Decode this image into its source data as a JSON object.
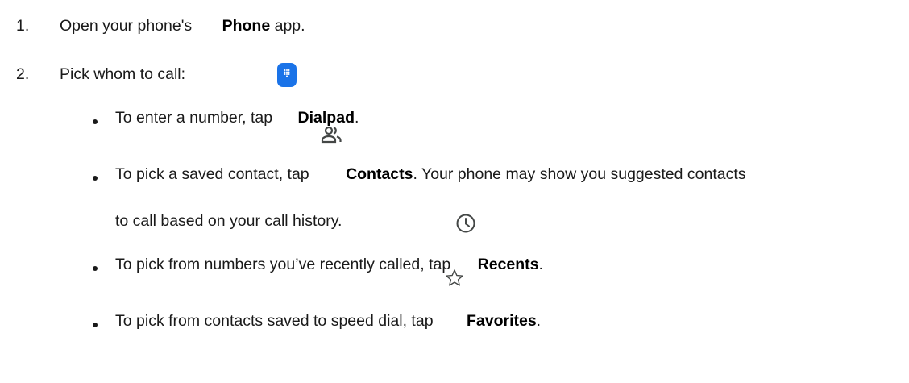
{
  "steps": [
    {
      "number": "1.",
      "before": "Open your phone's ",
      "bold": "Phone",
      "after": " app.",
      "icon": "phone-app-icon"
    },
    {
      "number": "2.",
      "text": "Pick whom to call:"
    }
  ],
  "bullets": [
    {
      "before": "To enter a number, tap ",
      "bold": "Dialpad",
      "after": ".",
      "icon": "dialpad-icon"
    },
    {
      "before": "To pick a saved contact, tap ",
      "bold": "Contacts",
      "after": ". Your phone may show you suggested contacts",
      "continuation": "to call based on your call history.",
      "icon": "contacts-icon"
    },
    {
      "before": "To pick from numbers you’ve recently called, tap ",
      "bold": "Recents",
      "after": ".",
      "icon": "clock-icon"
    },
    {
      "before": "To pick from contacts saved to speed dial, tap ",
      "bold": "Favorites",
      "after": ".",
      "icon": "star-icon"
    }
  ],
  "colors": {
    "accent": "#1a73e8",
    "text": "#1a1a1a",
    "icon_outline": "#444746"
  }
}
